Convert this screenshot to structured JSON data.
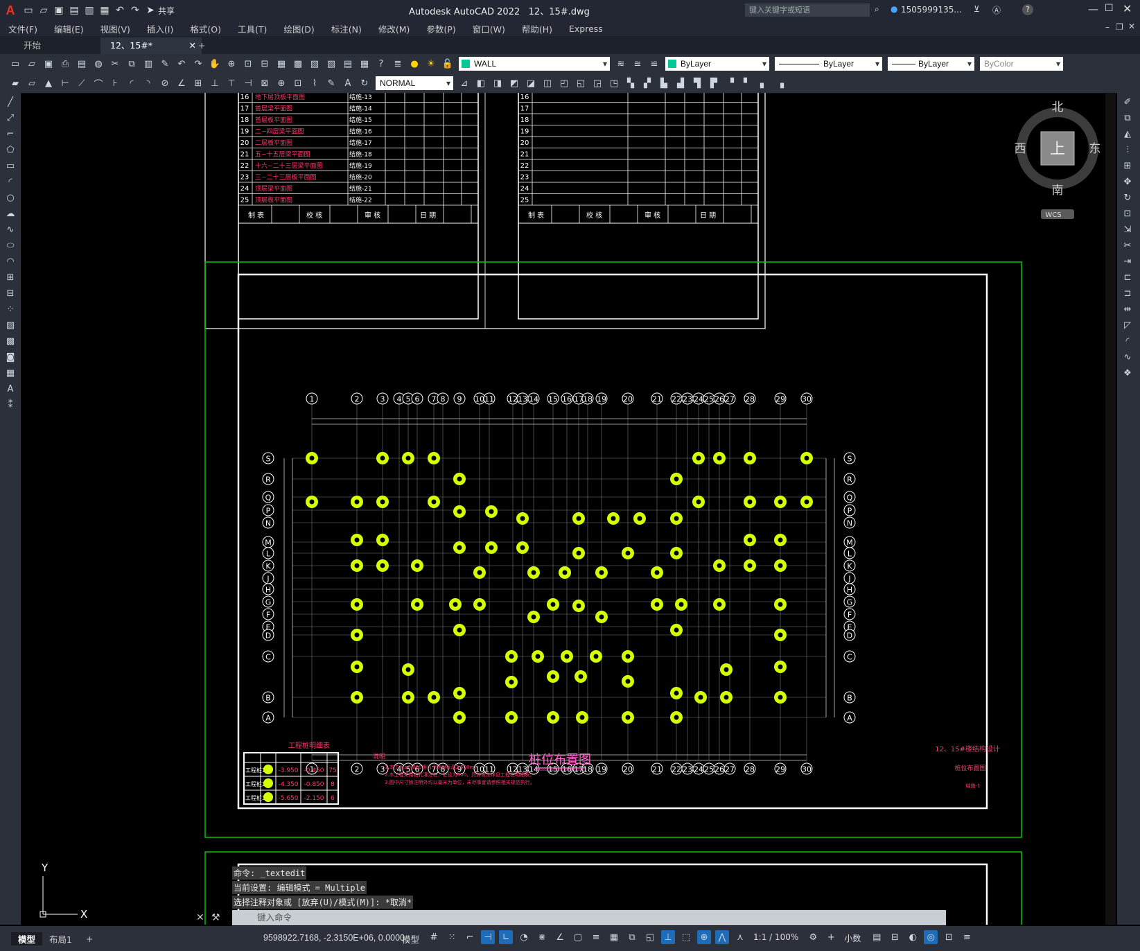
{
  "app": {
    "logo": "A",
    "title": "Autodesk AutoCAD 2022",
    "filename": "12、15#.dwg",
    "search_placeholder": "键入关键字或短语",
    "user": "1505999135...",
    "share": "共享",
    "help": "?"
  },
  "menu": [
    "文件(F)",
    "编辑(E)",
    "视图(V)",
    "插入(I)",
    "格式(O)",
    "工具(T)",
    "绘图(D)",
    "标注(N)",
    "修改(M)",
    "参数(P)",
    "窗口(W)",
    "帮助(H)",
    "Express"
  ],
  "tabs": {
    "start": "开始",
    "doc": "12、15#*",
    "add": "+"
  },
  "toolbar": {
    "layer": "WALL",
    "color": "ByLayer",
    "linetype": "ByLayer",
    "lineweight": "ByLayer",
    "plotstyle": "ByColor",
    "textstyle": "NORMAL"
  },
  "viewcube": {
    "north": "北",
    "south": "南",
    "east": "东",
    "west": "西",
    "top": "上",
    "wcs": "WCS"
  },
  "drawing": {
    "title": "桩位布置图",
    "project": "12、15#楼结构设计",
    "sheet_name": "桩位布置图",
    "sheet_no": "结施-1",
    "legend_title": "工程桩明细表",
    "legend_rows": [
      {
        "name": "工程桩1",
        "top": "-3.950",
        "cut": "-0.450",
        "count": "75"
      },
      {
        "name": "工程桩2",
        "top": "-4.350",
        "cut": "-0.850",
        "count": "8"
      },
      {
        "name": "工程桩3",
        "top": "-5.650",
        "cut": "-2.150",
        "count": "6"
      }
    ],
    "notes_title": "说明",
    "notes": [
      "1.本工程±0.000相当于绝对标高3.500m。",
      "2.本工程采用钻孔灌注桩，桩径为600，具体做法详见工程桩明细表。",
      "3.图中尺寸除注明外均以毫米为单位，未尽事宜请参照相关规范执行。"
    ],
    "grid_cols": [
      "1",
      "2",
      "3",
      "4",
      "5",
      "6",
      "7",
      "8",
      "9",
      "10",
      "11",
      "12",
      "13",
      "14",
      "15",
      "16",
      "17",
      "18",
      "19",
      "20",
      "21",
      "22",
      "23",
      "24",
      "25",
      "26",
      "27",
      "28",
      "29",
      "30"
    ],
    "grid_rows": [
      "S",
      "R",
      "Q",
      "P",
      "N",
      "M",
      "L",
      "K",
      "J",
      "H",
      "G",
      "F",
      "E",
      "D",
      "C",
      "B",
      "A"
    ],
    "sched_rows": [
      {
        "no": "16",
        "name": "地下层顶板平面图",
        "code": "结施-13"
      },
      {
        "no": "17",
        "name": "首层梁平面图",
        "code": "结施-14"
      },
      {
        "no": "18",
        "name": "首层板平面图",
        "code": "结施-15"
      },
      {
        "no": "19",
        "name": "二~四层梁平面图",
        "code": "结施-16"
      },
      {
        "no": "20",
        "name": "二层板平面图",
        "code": "结施-17"
      },
      {
        "no": "21",
        "name": "五~十五层梁平面图",
        "code": "结施-18"
      },
      {
        "no": "22",
        "name": "十六~二十三层梁平面图",
        "code": "结施-19"
      },
      {
        "no": "23",
        "name": "三~二十三层板平面图",
        "code": "结施-20"
      },
      {
        "no": "24",
        "name": "顶层梁平面图",
        "code": "结施-21"
      },
      {
        "no": "25",
        "name": "顶层板平面图",
        "code": "结施-22"
      }
    ],
    "sched_footer": [
      "制 表",
      "校 核",
      "审 核",
      "日 期"
    ]
  },
  "command": {
    "history": [
      "命令: _textedit",
      "当前设置: 编辑模式 = Multiple",
      "选择注释对象或 [放弃(U)/模式(M)]: *取消*"
    ],
    "placeholder": "键入命令"
  },
  "status": {
    "model_tab": "模型",
    "layout_tab": "布局1",
    "add": "+",
    "coords": "9598922.7168, -2.3150E+06, 0.0000",
    "space": "模型",
    "scale": "1:1 / 100%",
    "units": "小数"
  },
  "ucs": {
    "x": "X",
    "y": "Y"
  },
  "colors": {
    "pile": "#d4ff00",
    "frame": "#00c800",
    "text_red": "#ff3a6a",
    "grid": "#cfcfcf",
    "title_pink": "#ff66cc"
  }
}
